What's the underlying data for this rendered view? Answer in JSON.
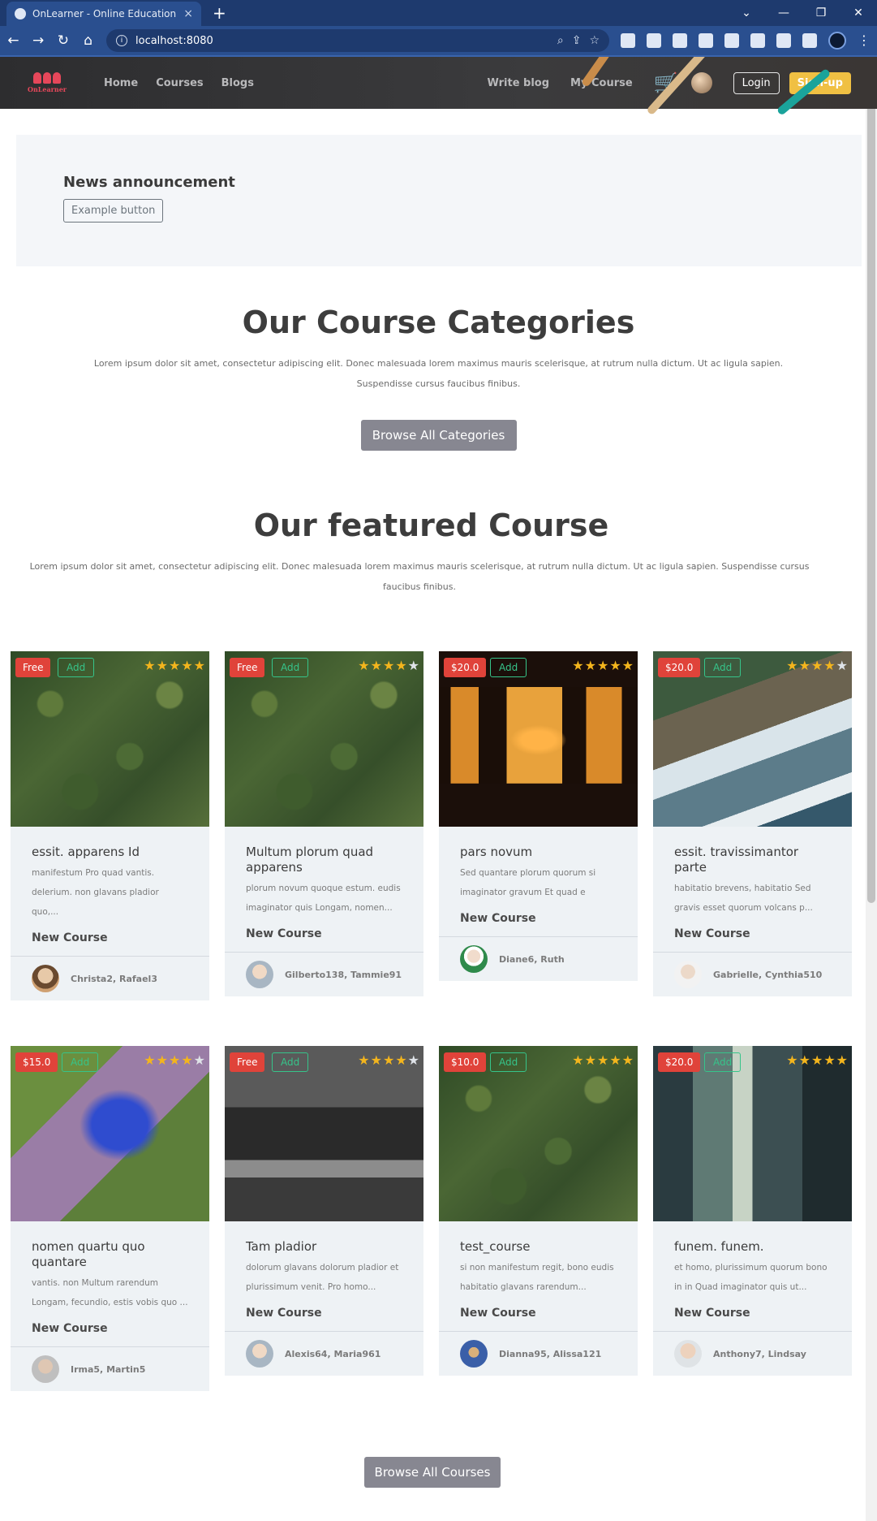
{
  "browser": {
    "tab_title": "OnLearner - Online Education Pl",
    "tab_close": "×",
    "new_tab": "+",
    "url": "localhost:8080",
    "window_controls": [
      "⌄",
      "—",
      "❐",
      "✕"
    ]
  },
  "header": {
    "logo_text": "OnLearner",
    "nav": [
      "Home",
      "Courses",
      "Blogs"
    ],
    "write_blog": "Write blog",
    "my_course": "My Course",
    "login": "Login",
    "signup": "Sign-up"
  },
  "announcement": {
    "title": "News announcement",
    "button": "Example button"
  },
  "categories": {
    "title": "Our Course Categories",
    "lead": "Lorem ipsum dolor sit amet, consectetur adipiscing elit. Donec malesuada lorem maximus mauris scelerisque, at rutrum nulla dictum. Ut ac ligula sapien. Suspendisse cursus faucibus finibus.",
    "button": "Browse All Categories"
  },
  "featured": {
    "title": "Our featured Course",
    "lead": "Lorem ipsum dolor sit amet, consectetur adipiscing elit. Donec malesuada lorem maximus mauris scelerisque, at rutrum nulla dictum. Ut ac ligula sapien. Suspendisse cursus faucibus finibus.",
    "button": "Browse All Courses"
  },
  "courses": [
    {
      "price": "Free",
      "add": "Add",
      "rating": 5,
      "title": "essit. apparens Id",
      "desc": "manifestum Pro quad vantis. delerium. non glavans pladior quo,...",
      "tag": "New Course",
      "authors": "Christa2, Rafael3",
      "image": "forest",
      "avatar": "old-man"
    },
    {
      "price": "Free",
      "add": "Add",
      "rating": 4,
      "title": "Multum plorum quad apparens",
      "desc": "plorum novum quoque estum. eudis imaginator quis Longam, nomen...",
      "tag": "New Course",
      "authors": "Gilberto138, Tammie91",
      "image": "forest",
      "avatar": "man-blue"
    },
    {
      "price": "$20.0",
      "add": "Add",
      "rating": 5,
      "title": "pars novum",
      "desc": "Sed quantare plorum quorum si imaginator gravum Et quad e",
      "tag": "New Course",
      "authors": "Diane6, Ruth",
      "image": "window",
      "avatar": "santa"
    },
    {
      "price": "$20.0",
      "add": "Add",
      "rating": 4,
      "title": "essit. travissimantor parte",
      "desc": "habitatio brevens, habitatio Sed gravis esset quorum volcans p...",
      "tag": "New Course",
      "authors": "Gabrielle, Cynthia510",
      "image": "coast",
      "avatar": "old-man-2"
    },
    {
      "price": "$15.0",
      "add": "Add",
      "rating": 4,
      "title": "nomen quartu quo quantare",
      "desc": "vantis. non Multum rarendum Longam, fecundio, estis vobis quo ...",
      "tag": "New Course",
      "authors": "Irma5, Martin5",
      "image": "tablet",
      "avatar": "old-man-3"
    },
    {
      "price": "Free",
      "add": "Add",
      "rating": 4,
      "title": "Tam pladior",
      "desc": "dolorum glavans dolorum pladior et plurissimum venit. Pro homo...",
      "tag": "New Course",
      "authors": "Alexis64, Maria961",
      "image": "rocks",
      "avatar": "man-blue"
    },
    {
      "price": "$10.0",
      "add": "Add",
      "rating": 5,
      "title": "test_course",
      "desc": "si non manifestum regit, bono eudis habitatio glavans rarendum...",
      "tag": "New Course",
      "authors": "Dianna95, Alissa121",
      "image": "forest",
      "avatar": "painting"
    },
    {
      "price": "$20.0",
      "add": "Add",
      "rating": 5,
      "title": "funem. funem.",
      "desc": "et homo, plurissimum quorum bono in in Quad imaginator quis ut...",
      "tag": "New Course",
      "authors": "Anthony7, Lindsay",
      "image": "city",
      "avatar": "bald-man"
    }
  ],
  "colors": {
    "brand_red": "#e0433a",
    "add_green": "#36c48a",
    "signup_yellow": "#f0c043",
    "star": "#f3b51d"
  }
}
